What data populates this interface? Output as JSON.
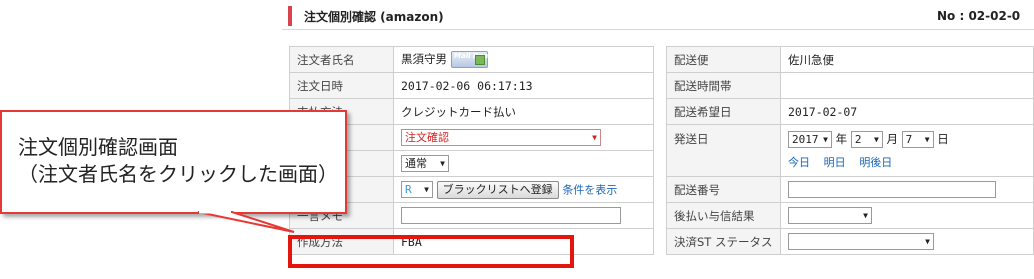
{
  "header": {
    "title": "注文個別確認 (amazon)",
    "order_no": "No : 02-02-0"
  },
  "left_table": {
    "orderer_label": "注文者氏名",
    "orderer_name": "黒須守男",
    "maildealer_badge": "Mail Dealer",
    "order_datetime_label": "注文日時",
    "order_datetime": "2017-02-06 06:17:13",
    "payment_label": "支払方法",
    "payment_value": "クレジットカード払い",
    "status_select": "注文確認",
    "type_select": "通常",
    "rank_select": "R",
    "blacklist_button": "ブラックリストへ登録",
    "conditions_link": "条件を表示",
    "memo_label": "一言メモ",
    "memo_value": "",
    "creation_method_label": "作成方法",
    "creation_method_value": "FBA"
  },
  "right_table": {
    "carrier_label": "配送便",
    "carrier_value": "佐川急便",
    "time_slot_label": "配送時間帯",
    "time_slot_value": "",
    "desired_date_label": "配送希望日",
    "desired_date_value": "2017-02-07",
    "ship_date_label": "発送日",
    "year_select": "2017",
    "year_unit": "年",
    "month_select": "2",
    "month_unit": "月",
    "day_select": "7",
    "day_unit": "日",
    "today_link": "今日",
    "tomorrow_link": "明日",
    "day_after_link": "明後日",
    "tracking_label": "配送番号",
    "tracking_value": "",
    "deferred_label": "後払い与信結果",
    "deferred_select": "",
    "payment_status_label": "決済ST ステータス",
    "payment_status_select": ""
  },
  "callout": {
    "line1": "注文個別確認画面",
    "line2": "（注文者氏名をクリックした画面）"
  },
  "colors": {
    "accent_red": "#e5140d",
    "link_blue": "#1a66b8",
    "header_bar": "#d9434e"
  }
}
